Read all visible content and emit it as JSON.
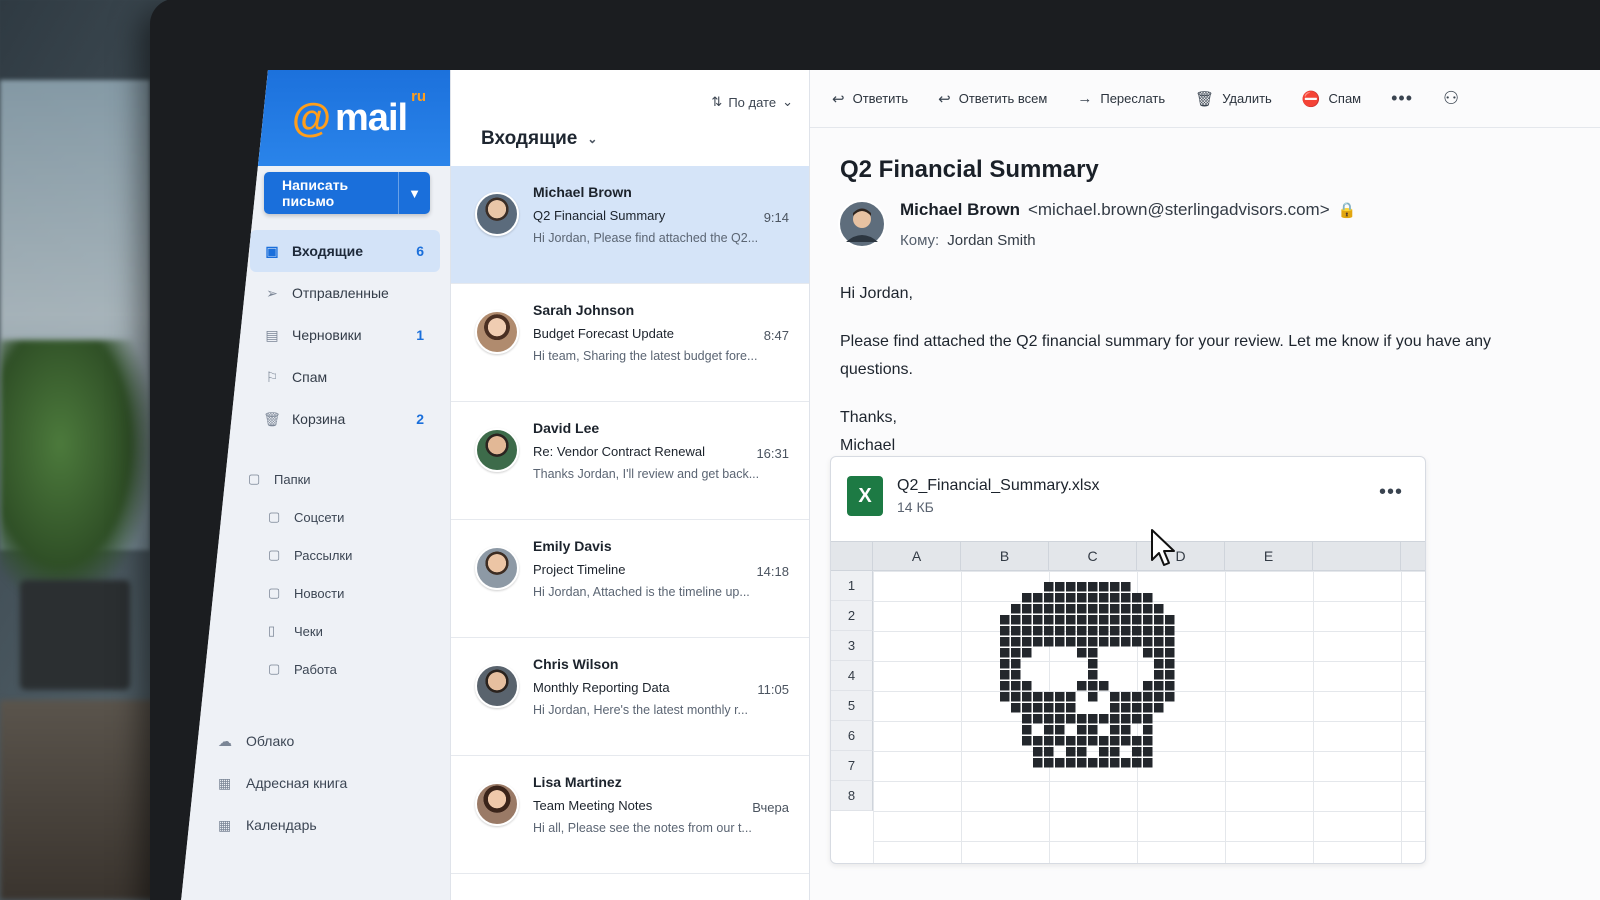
{
  "app": {
    "logo_text": "mail",
    "logo_sup": "ru",
    "compose_label": "Написать письмо"
  },
  "sidebar": {
    "nav": [
      {
        "label": "Входящие",
        "count": "6",
        "icon": "inbox-icon"
      },
      {
        "label": "Отправленные",
        "count": "",
        "icon": "send-icon"
      },
      {
        "label": "Черновики",
        "count": "1",
        "icon": "draft-icon"
      },
      {
        "label": "Спам",
        "count": "",
        "icon": "spam-icon"
      },
      {
        "label": "Корзина",
        "count": "2",
        "icon": "trash-icon"
      }
    ],
    "folders_title": "Папки",
    "folders": [
      "Соцсети",
      "Рассылки",
      "Новости",
      "Чеки",
      "Работа"
    ],
    "bottom": [
      "Облако",
      "Адресная книга",
      "Календарь"
    ]
  },
  "list": {
    "title": "Входящие",
    "sort_label": "По дате",
    "messages": [
      {
        "from": "Michael Brown",
        "subject": "Q2 Financial Summary",
        "preview": "Hi Jordan, Please find attached the Q2...",
        "time": "9:14"
      },
      {
        "from": "Sarah Johnson",
        "subject": "Budget Forecast Update",
        "preview": "Hi team, Sharing the latest budget fore...",
        "time": "8:47"
      },
      {
        "from": "David Lee",
        "subject": "Re: Vendor Contract Renewal",
        "preview": "Thanks Jordan, I'll review and get back...",
        "time": "16:31"
      },
      {
        "from": "Emily Davis",
        "subject": "Project Timeline",
        "preview": "Hi Jordan, Attached is the timeline up...",
        "time": "14:18"
      },
      {
        "from": "Chris Wilson",
        "subject": "Monthly Reporting Data",
        "preview": "Hi Jordan, Here's the latest monthly r...",
        "time": "11:05"
      },
      {
        "from": "Lisa Martinez",
        "subject": "Team Meeting Notes",
        "preview": "Hi all, Please see the notes from our t...",
        "time": "Вчера"
      }
    ]
  },
  "toolbar": {
    "reply": "Ответить",
    "reply_all": "Ответить всем",
    "forward": "Переслать",
    "delete": "Удалить",
    "spam": "Спам"
  },
  "email": {
    "subject": "Q2 Financial Summary",
    "sender_name": "Michael Brown",
    "sender_email": "<michael.brown@sterlingadvisors.com>",
    "to_label": "Кому:",
    "to_name": "Jordan Smith",
    "greeting": "Hi Jordan,",
    "body": "Please find attached the Q2 financial summary for your review. Let me know if you have any questions.",
    "signoff": "Thanks,",
    "signature": "Michael"
  },
  "attachment": {
    "filename": "Q2_Financial_Summary.xlsx",
    "size": "14 КБ",
    "icon_letter": "X",
    "columns": [
      "A",
      "B",
      "C",
      "D",
      "E"
    ],
    "rows": [
      "1",
      "2",
      "3",
      "4",
      "5",
      "6",
      "7",
      "8"
    ]
  }
}
